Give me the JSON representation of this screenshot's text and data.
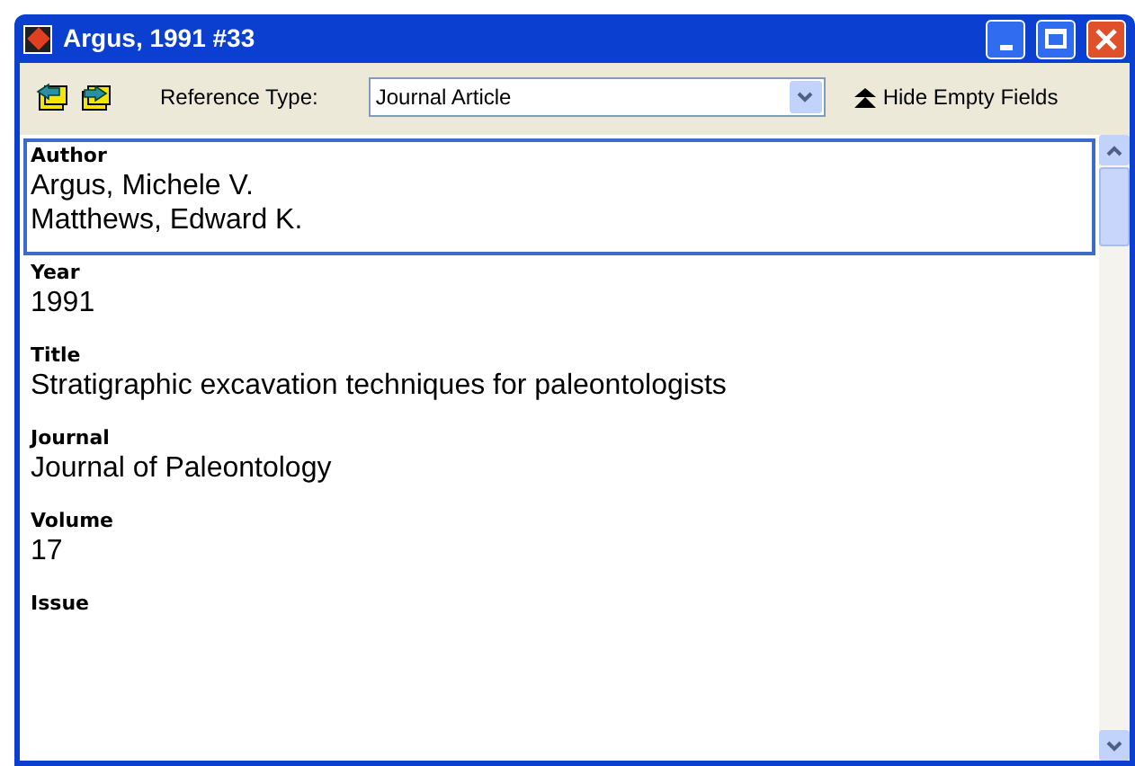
{
  "window": {
    "title": "Argus, 1991 #33"
  },
  "toolbar": {
    "reference_type_label": "Reference Type:",
    "reference_type": "Journal Article",
    "hide_empty_fields": "Hide Empty Fields"
  },
  "fields": [
    {
      "label": "Author",
      "values": [
        "Argus, Michele V.",
        "Matthews, Edward K."
      ],
      "selected": true
    },
    {
      "label": "Year",
      "values": [
        "1991"
      ],
      "selected": false
    },
    {
      "label": "Title",
      "values": [
        "Stratigraphic excavation techniques for paleontologists"
      ],
      "selected": false
    },
    {
      "label": "Journal",
      "values": [
        "Journal of Paleontology"
      ],
      "selected": false
    },
    {
      "label": "Volume",
      "values": [
        "17"
      ],
      "selected": false
    },
    {
      "label": "Issue",
      "selected": false
    }
  ]
}
